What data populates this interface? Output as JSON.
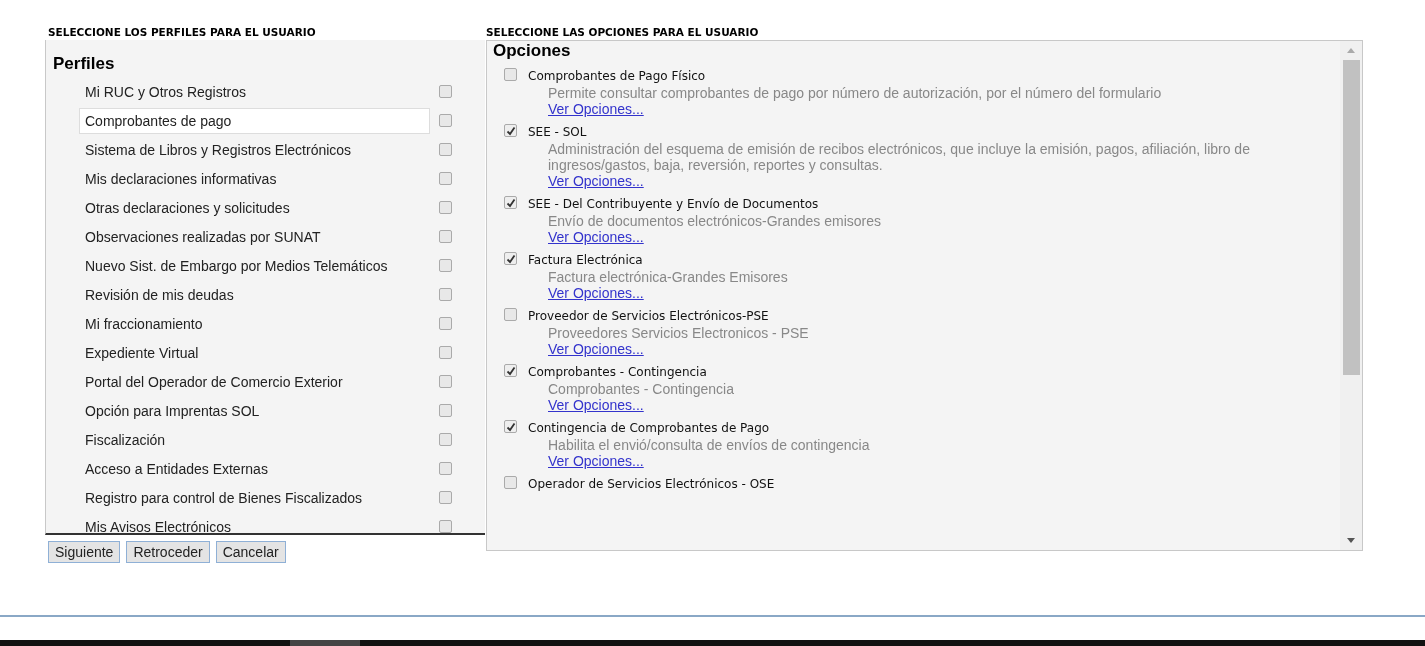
{
  "headings": {
    "perfiles": "SELECCIONE LOS PERFILES PARA EL USUARIO",
    "opciones": "SELECCIONE LAS OPCIONES PARA EL USUARIO"
  },
  "perfiles": {
    "title": "Perfiles",
    "items": [
      {
        "label": "Mi RUC y Otros Registros",
        "selected": false,
        "checked": false
      },
      {
        "label": "Comprobantes de pago",
        "selected": true,
        "checked": false
      },
      {
        "label": "Sistema de Libros y Registros Electrónicos",
        "selected": false,
        "checked": false
      },
      {
        "label": "Mis declaraciones informativas",
        "selected": false,
        "checked": false
      },
      {
        "label": "Otras declaraciones y solicitudes",
        "selected": false,
        "checked": false
      },
      {
        "label": "Observaciones realizadas por SUNAT",
        "selected": false,
        "checked": false
      },
      {
        "label": "Nuevo Sist. de Embargo por Medios Telemáticos",
        "selected": false,
        "checked": false
      },
      {
        "label": "Revisión de mis deudas",
        "selected": false,
        "checked": false
      },
      {
        "label": "Mi fraccionamiento",
        "selected": false,
        "checked": false
      },
      {
        "label": "Expediente Virtual",
        "selected": false,
        "checked": false
      },
      {
        "label": "Portal del Operador de Comercio Exterior",
        "selected": false,
        "checked": false
      },
      {
        "label": "Opción para Imprentas SOL",
        "selected": false,
        "checked": false
      },
      {
        "label": "Fiscalización",
        "selected": false,
        "checked": false
      },
      {
        "label": "Acceso a Entidades Externas",
        "selected": false,
        "checked": false
      },
      {
        "label": "Registro para control de Bienes Fiscalizados",
        "selected": false,
        "checked": false
      },
      {
        "label": "Mis Avisos Electrónicos",
        "selected": false,
        "checked": false
      }
    ]
  },
  "opciones": {
    "title": "Opciones",
    "items": [
      {
        "name": "Comprobantes de Pago Físico",
        "description": "Permite consultar comprobantes de pago por número de autorización, por el número del formulario",
        "link": "Ver Opciones...",
        "checked": false
      },
      {
        "name": "SEE - SOL",
        "description": "Administración del esquema de emisión de recibos electrónicos, que incluye la emisión, pagos, afiliación, libro de ingresos/gastos, baja, reversión, reportes y consultas.",
        "link": "Ver Opciones...",
        "checked": true
      },
      {
        "name": "SEE - Del Contribuyente y Envío de Documentos",
        "description": "Envío de documentos electrónicos-Grandes emisores",
        "link": "Ver Opciones...",
        "checked": true
      },
      {
        "name": "Factura Electrónica",
        "description": "Factura electrónica-Grandes Emisores",
        "link": "Ver Opciones...",
        "checked": true
      },
      {
        "name": "Proveedor de Servicios Electrónicos-PSE",
        "description": "Proveedores Servicios Electronicos - PSE",
        "link": "Ver Opciones...",
        "checked": false
      },
      {
        "name": "Comprobantes - Contingencia",
        "description": "Comprobantes - Contingencia",
        "link": "Ver Opciones...",
        "checked": true
      },
      {
        "name": "Contingencia de Comprobantes de Pago",
        "description": "Habilita el envió/consulta de envíos de contingencia",
        "link": "Ver Opciones...",
        "checked": true
      },
      {
        "name": "Operador de Servicios Electrónicos - OSE",
        "checked": false
      }
    ]
  },
  "buttons": [
    "Siguiente",
    "Retroceder",
    "Cancelar"
  ]
}
